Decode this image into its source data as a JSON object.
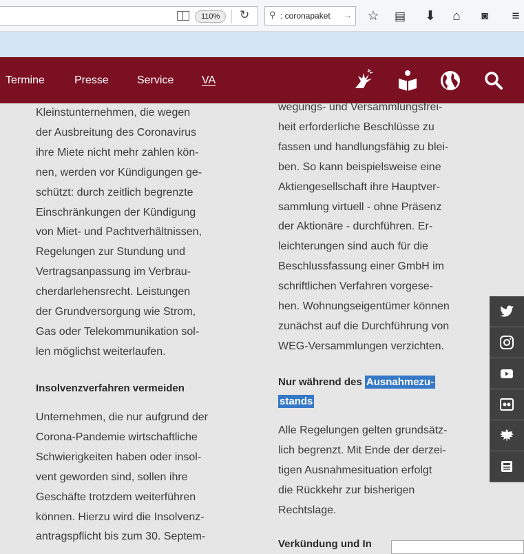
{
  "browser": {
    "zoom": "110%",
    "search_text": ": coronapaket",
    "accent": "#d3e4f2"
  },
  "nav": {
    "items": [
      "Termine",
      "Presse",
      "Service",
      "VA"
    ],
    "icons": [
      "sign-language-icon",
      "easy-language-icon",
      "globe-icon",
      "search-icon"
    ],
    "color": "#7b1023"
  },
  "left_column": {
    "paragraph1": [
      "Kleinstunternehmen, die wegen",
      "der Ausbreitung des Coronavirus",
      "ihre Miete nicht mehr zahlen kön-",
      "nen, werden vor Kündigungen ge-",
      "schützt: durch zeitlich begrenzte",
      "Einschränkungen der Kündigung",
      "von Miet- und Pachtverhältnissen,",
      "Regelungen zur Stundung und",
      "Vertragsanpassung im Verbrau-",
      "cherdarlehensrecht. Leistungen",
      "der Grundversorgung wie Strom,",
      "Gas oder Telekommunikation sol-",
      "len möglichst weiterlaufen."
    ],
    "heading": "Insolvenzverfahren vermeiden",
    "paragraph2": [
      "Unternehmen, die nur aufgrund der",
      "Corona-Pandemie wirtschaftliche",
      "Schwierigkeiten haben oder insol-",
      "vent geworden sind, sollen ihre",
      "Geschäfte trotzdem weiterführen",
      "können. Hierzu wird die Insolvenz-",
      "antragspflicht bis zum 30. Septem-"
    ]
  },
  "right_column": {
    "paragraph1": [
      "wegungs- und Versammlungsfrei-",
      "heit erforderliche Beschlüsse zu",
      "fassen und handlungsfähig zu blei-",
      "ben. So kann beispielsweise eine",
      "Aktiengesellschaft ihre Hauptver-",
      "sammlung virtuell - ohne Präsenz",
      "der Aktionäre - durchführen. Er-",
      "leichterungen sind auch für die",
      "Beschlussfassung einer GmbH im",
      "schriftlichen Verfahren vorgese-",
      "hen. Wohnungseigentümer können",
      "zunächst auf die Durchführung von",
      "WEG-Versammlungen verzichten."
    ],
    "heading_prefix": "Nur während des ",
    "heading_highlight_1": "Ausnahmezu-",
    "heading_highlight_2": "stands",
    "paragraph2": [
      "Alle Regelungen gelten grundsätz-",
      "lich begrenzt. Mit Ende der derzei-",
      "tigen Ausnahmesituation erfolgt",
      "die Rückkehr zur bisherigen",
      "Rechtslage."
    ],
    "heading3": "Verkündung und In"
  },
  "social": [
    "twitter-icon",
    "instagram-icon",
    "youtube-icon",
    "flickr-icon",
    "eagle-icon",
    "newsletter-icon"
  ]
}
